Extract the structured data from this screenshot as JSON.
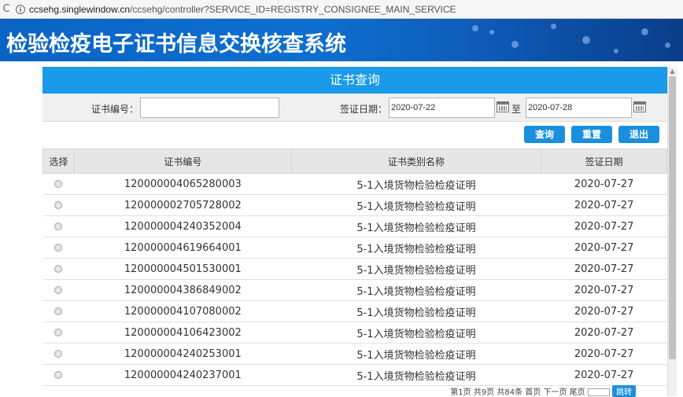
{
  "browser": {
    "url_prefix": "ccsehg.singlewindow.cn",
    "url_rest": "/ccsehg/controller?SERVICE_ID=REGISTRY_CONSIGNEE_MAIN_SERVICE"
  },
  "banner": {
    "title": "检验检疫电子证书信息交换核查系统"
  },
  "panel": {
    "title": "证书查询"
  },
  "form": {
    "cert_no_label": "证书编号：",
    "cert_no_value": "",
    "date_label": "签证日期：",
    "date_from": "2020-07-22",
    "date_sep": "至",
    "date_to": "2020-07-28"
  },
  "buttons": {
    "query": "查询",
    "reset": "重置",
    "exit": "退出"
  },
  "table": {
    "headers": [
      "选择",
      "证书编号",
      "证书类别名称",
      "签证日期"
    ],
    "rows": [
      {
        "no": "120000004065280003",
        "type": "5-1入境货物检验检疫证明",
        "date": "2020-07-27"
      },
      {
        "no": "120000002705728002",
        "type": "5-1入境货物检验检疫证明",
        "date": "2020-07-27"
      },
      {
        "no": "120000004240352004",
        "type": "5-1入境货物检验检疫证明",
        "date": "2020-07-27"
      },
      {
        "no": "120000004619664001",
        "type": "5-1入境货物检验检疫证明",
        "date": "2020-07-27"
      },
      {
        "no": "120000004501530001",
        "type": "5-1入境货物检验检疫证明",
        "date": "2020-07-27"
      },
      {
        "no": "120000004386849002",
        "type": "5-1入境货物检验检疫证明",
        "date": "2020-07-27"
      },
      {
        "no": "120000004107080002",
        "type": "5-1入境货物检验检疫证明",
        "date": "2020-07-27"
      },
      {
        "no": "120000004106423002",
        "type": "5-1入境货物检验检疫证明",
        "date": "2020-07-27"
      },
      {
        "no": "120000004240253001",
        "type": "5-1入境货物检验检疫证明",
        "date": "2020-07-27"
      },
      {
        "no": "120000004240237001",
        "type": "5-1入境货物检验检疫证明",
        "date": "2020-07-27"
      }
    ]
  },
  "pager": {
    "text": "第1页 共9页 共84条 首页 下一页 尾页",
    "go": "跳转"
  }
}
